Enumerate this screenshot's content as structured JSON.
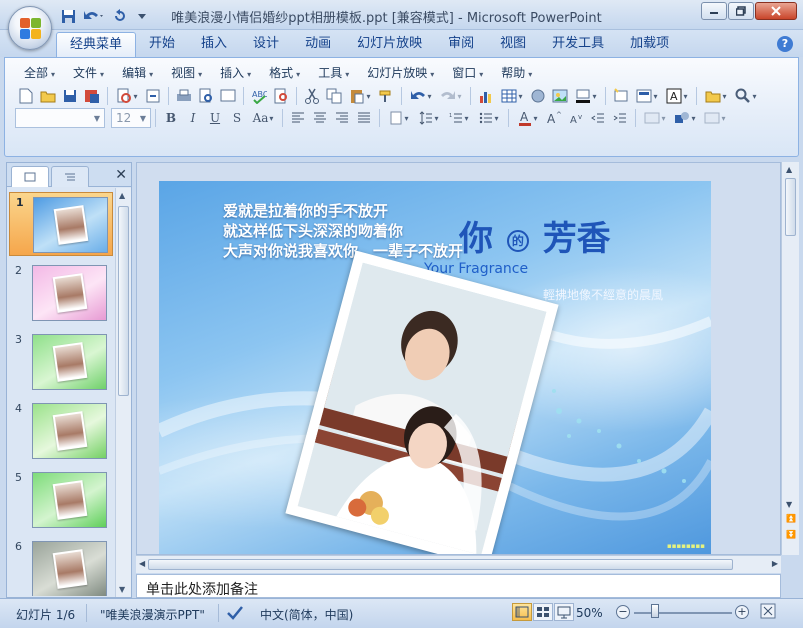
{
  "window": {
    "title": "唯美浪漫小情侣婚纱ppt相册模板.ppt [兼容模式] - Microsoft PowerPoint"
  },
  "ribbon_tabs": [
    "经典菜单",
    "开始",
    "插入",
    "设计",
    "动画",
    "幻灯片放映",
    "审阅",
    "视图",
    "开发工具",
    "加载项"
  ],
  "active_tab": "经典菜单",
  "menus": [
    "全部",
    "文件",
    "编辑",
    "视图",
    "插入",
    "格式",
    "工具",
    "幻灯片放映",
    "窗口",
    "帮助"
  ],
  "toolbar": {
    "font_size": "12",
    "bold": "B",
    "italic": "I",
    "underline": "U",
    "strike": "S",
    "case": "Aa"
  },
  "slides": [
    {
      "num": "1",
      "selected": true
    },
    {
      "num": "2",
      "selected": false
    },
    {
      "num": "3",
      "selected": false
    },
    {
      "num": "4",
      "selected": false
    },
    {
      "num": "5",
      "selected": false
    },
    {
      "num": "6",
      "selected": false
    }
  ],
  "slide_content": {
    "poem": [
      "爱就是拉着你的手不放开",
      "就这样低下头深深的吻着你",
      "大声对你说我喜欢你，一辈子不放开"
    ],
    "title_cn_1": "你",
    "title_cn_mid": "的",
    "title_cn_2": "芳香",
    "title_en": "Your Fragrance",
    "subtitle": "輕拂地像不經意的晨風"
  },
  "notes_placeholder": "单击此处添加备注",
  "status": {
    "slide_counter": "幻灯片 1/6",
    "theme": "\"唯美浪漫演示PPT\"",
    "language": "中文(简体，中国)",
    "zoom": "50%"
  },
  "colors": {
    "accent": "#15428b",
    "selection": "#f5a64b",
    "slide_title": "#1f55b8"
  }
}
